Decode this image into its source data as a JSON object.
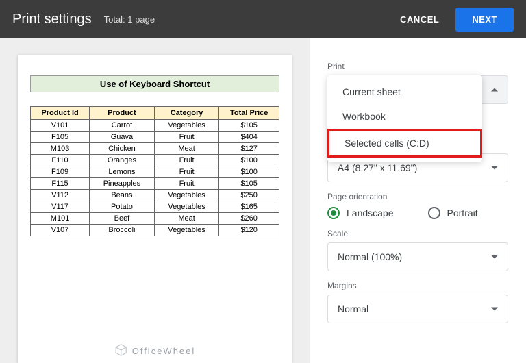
{
  "header": {
    "title": "Print settings",
    "sub": "Total: 1 page",
    "cancel": "CANCEL",
    "next": "NEXT"
  },
  "preview": {
    "title": "Use of Keyboard Shortcut",
    "columns": [
      "Product Id",
      "Product",
      "Category",
      "Total Price"
    ],
    "rows": [
      [
        "V101",
        "Carrot",
        "Vegetables",
        "$105"
      ],
      [
        "F105",
        "Guava",
        "Fruit",
        "$404"
      ],
      [
        "M103",
        "Chicken",
        "Meat",
        "$127"
      ],
      [
        "F110",
        "Oranges",
        "Fruit",
        "$100"
      ],
      [
        "F109",
        "Lemons",
        "Fruit",
        "$100"
      ],
      [
        "F115",
        "Pineapples",
        "Fruit",
        "$105"
      ],
      [
        "V112",
        "Beans",
        "Vegetables",
        "$250"
      ],
      [
        "V117",
        "Potato",
        "Vegetables",
        "$165"
      ],
      [
        "M101",
        "Beef",
        "Meat",
        "$260"
      ],
      [
        "V107",
        "Broccoli",
        "Vegetables",
        "$120"
      ]
    ]
  },
  "sidebar": {
    "print_label": "Print",
    "print_options": [
      "Current sheet",
      "Workbook",
      "Selected cells (C:D)"
    ],
    "paper_size_partial": "A4 (8.27\" x 11.69\")",
    "orientation_label": "Page orientation",
    "orientation": {
      "landscape": "Landscape",
      "portrait": "Portrait"
    },
    "scale_label": "Scale",
    "scale_value": "Normal (100%)",
    "margins_label": "Margins",
    "margins_value": "Normal"
  },
  "watermark": {
    "text": "OfficeWheel"
  }
}
